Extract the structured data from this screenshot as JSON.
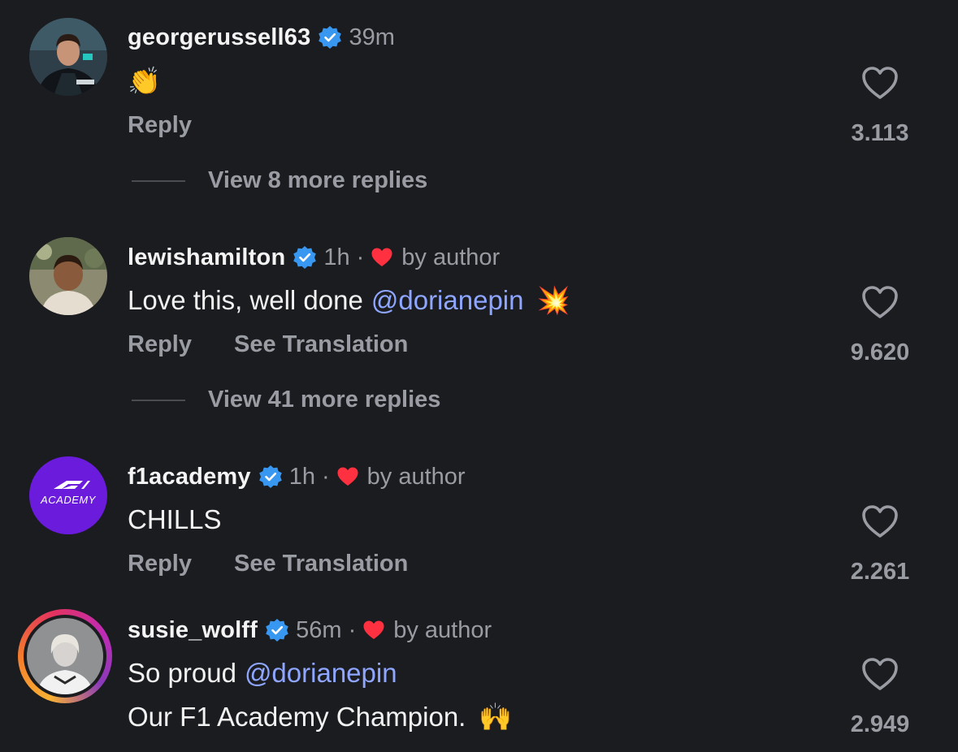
{
  "colors": {
    "background": "#1b1c20",
    "verified": "#3897f0",
    "heart_red": "#ff3040",
    "mention": "#8ea6ff",
    "muted": "#9a9ca3",
    "f1academy_avatar": "#6a1bdc"
  },
  "comments": [
    {
      "username": "georgerussell63",
      "time": "39m",
      "body": "👏",
      "reply_label": "Reply",
      "likes": "3.113",
      "view_more": "View 8 more replies",
      "avatar_icon": "racing-driver-avatar"
    },
    {
      "username": "lewishamilton",
      "time": "1h",
      "liked_by_author": "by author",
      "body": "Love this, well done",
      "mention": "@dorianepin",
      "emoji": "💥",
      "reply_label": "Reply",
      "translate_label": "See Translation",
      "likes": "9.620",
      "view_more": "View 41 more replies",
      "avatar_icon": "child-photo-avatar"
    },
    {
      "username": "f1academy",
      "time": "1h",
      "liked_by_author": "by author",
      "body": "CHILLS",
      "reply_label": "Reply",
      "translate_label": "See Translation",
      "likes": "2.261",
      "avatar_logo_text": "ACADEMY",
      "avatar_icon": "f1-academy-logo-avatar"
    },
    {
      "username": "susie_wolff",
      "time": "56m",
      "liked_by_author": "by author",
      "body_line1": "So proud",
      "mention": "@dorianepin",
      "body_line2": "Our F1 Academy Champion.",
      "emoji": "🙌",
      "likes": "2.949",
      "avatar_icon": "portrait-avatar-with-story-ring"
    }
  ],
  "separator": "·"
}
